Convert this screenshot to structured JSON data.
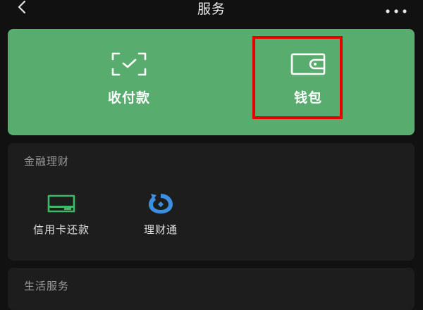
{
  "header": {
    "title": "服务",
    "back_icon": "chevron-left-icon",
    "more_icon": "more-dots-icon"
  },
  "primary": {
    "items": [
      {
        "label": "收付款",
        "icon": "scan-check-icon"
      },
      {
        "label": "钱包",
        "icon": "wallet-icon"
      }
    ],
    "background_color": "#58ad6e",
    "highlight_color": "#e60000"
  },
  "finance": {
    "title": "金融理财",
    "items": [
      {
        "label": "信用卡还款",
        "icon": "credit-card-icon",
        "color": "#3fb86a"
      },
      {
        "label": "理财通",
        "icon": "licaitong-icon",
        "color": "#3a8fe0"
      }
    ]
  },
  "life": {
    "title": "生活服务"
  }
}
